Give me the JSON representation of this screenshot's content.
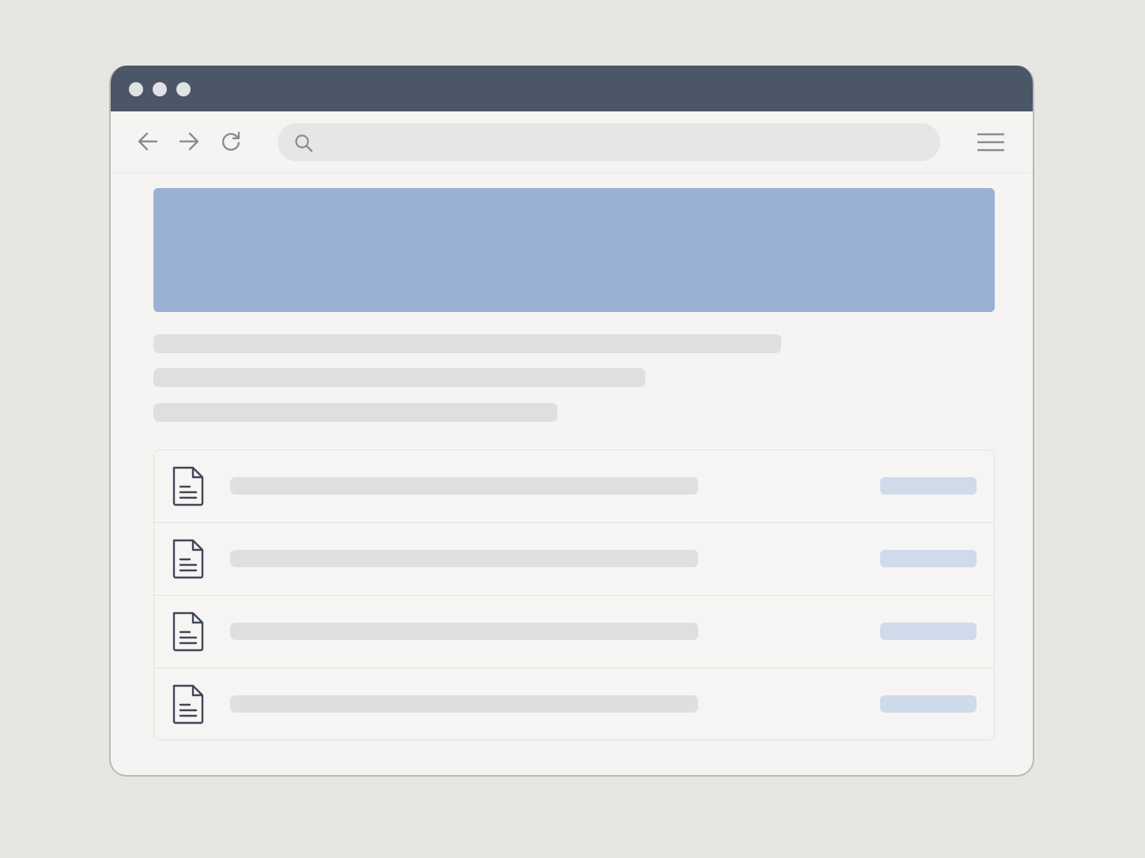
{
  "window": {
    "title_bar_color": "#4b5667",
    "controls": [
      "window-dot-1",
      "window-dot-2",
      "window-dot-3"
    ]
  },
  "toolbar": {
    "back_icon": "arrow-left-icon",
    "forward_icon": "arrow-right-icon",
    "reload_icon": "reload-icon",
    "menu_icon": "hamburger-menu-icon",
    "address": {
      "value": "",
      "search_icon": "search-icon"
    }
  },
  "hero": {
    "color": "#99b2d4"
  },
  "placeholder_color": "#e0dfdd",
  "document_list": {
    "item_icon": "document-icon",
    "action_color": "#cfdbea",
    "items": [
      {
        "icon": "document-icon"
      },
      {
        "icon": "document-icon"
      },
      {
        "icon": "document-icon"
      },
      {
        "icon": "document-icon"
      }
    ]
  }
}
